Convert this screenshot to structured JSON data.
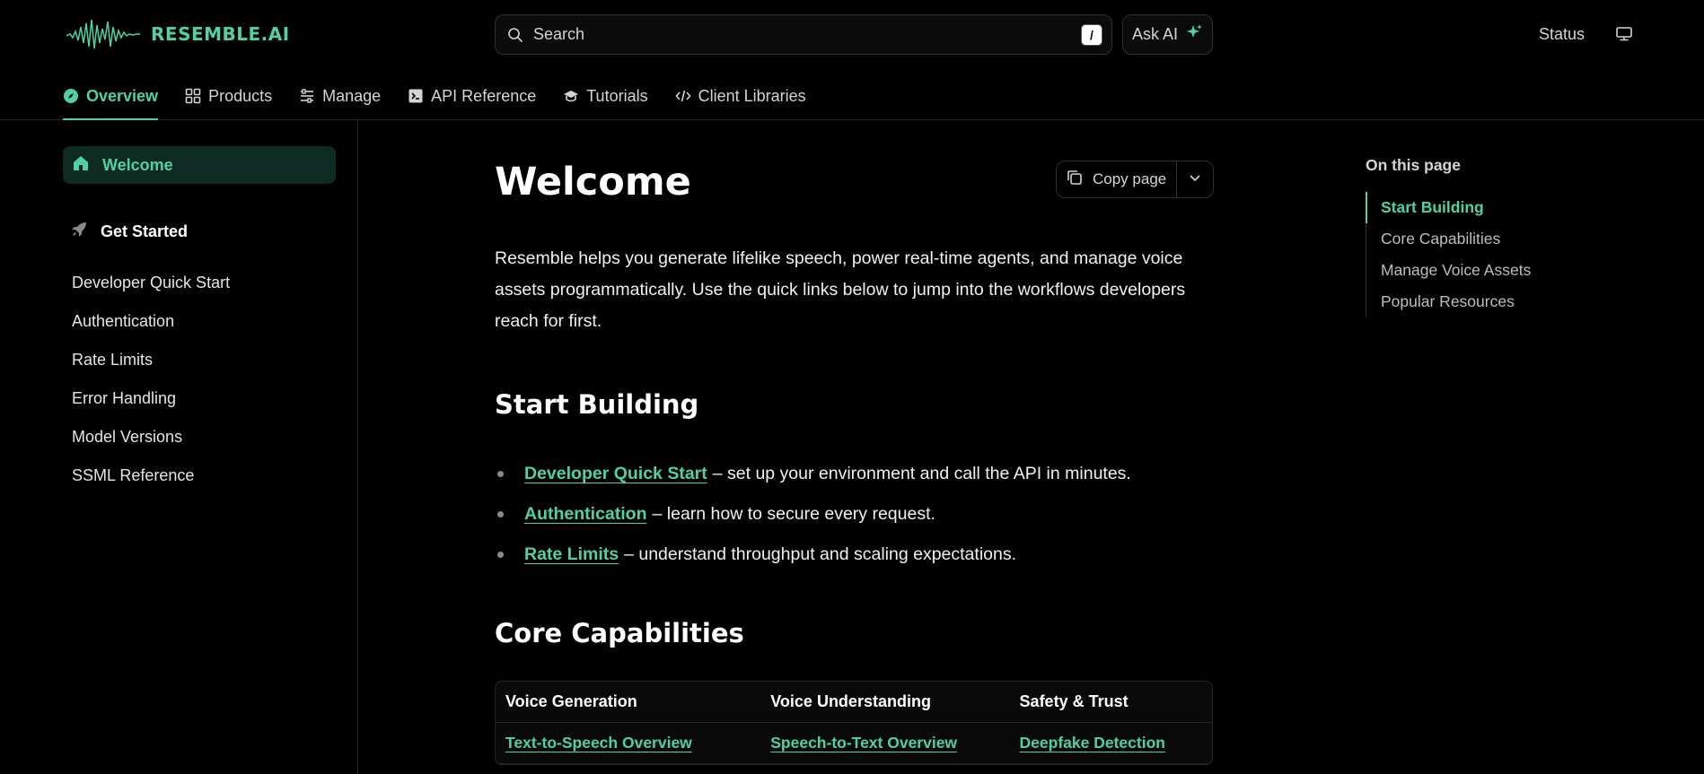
{
  "brand": {
    "name": "RESEMBLE.AI",
    "accent_color": "#4fd1a5"
  },
  "header": {
    "search": {
      "placeholder": "Search",
      "shortcut": "/"
    },
    "ask_ai_label": "Ask AI",
    "status_label": "Status",
    "theme_icon": "monitor-icon"
  },
  "tabs": [
    {
      "label": "Overview",
      "icon": "compass-icon",
      "active": true
    },
    {
      "label": "Products",
      "icon": "blocks-icon"
    },
    {
      "label": "Manage",
      "icon": "sliders-icon"
    },
    {
      "label": "API Reference",
      "icon": "terminal-icon"
    },
    {
      "label": "Tutorials",
      "icon": "graduation-cap-icon"
    },
    {
      "label": "Client Libraries",
      "icon": "code-icon"
    }
  ],
  "sidebar": {
    "active_item": {
      "label": "Welcome",
      "icon": "home-icon"
    },
    "group": {
      "label": "Get Started",
      "icon": "rocket-icon"
    },
    "items": [
      {
        "label": "Developer Quick Start"
      },
      {
        "label": "Authentication"
      },
      {
        "label": "Rate Limits"
      },
      {
        "label": "Error Handling"
      },
      {
        "label": "Model Versions"
      },
      {
        "label": "SSML Reference"
      }
    ]
  },
  "main": {
    "title": "Welcome",
    "copy_page_label": "Copy page",
    "intro": "Resemble helps you generate lifelike speech, power real-time agents, and manage voice assets programmatically. Use the quick links below to jump into the workflows developers reach for first.",
    "start_building": {
      "heading": "Start Building",
      "items": [
        {
          "link": "Developer Quick Start",
          "text": "– set up your environment and call the API in minutes."
        },
        {
          "link": "Authentication",
          "text": "– learn how to secure every request."
        },
        {
          "link": "Rate Limits",
          "text": "– understand throughput and scaling expectations."
        }
      ]
    },
    "core_capabilities": {
      "heading": "Core Capabilities",
      "columns": [
        "Voice Generation",
        "Voice Understanding",
        "Safety & Trust"
      ],
      "rows": [
        [
          "Text-to-Speech Overview",
          "Speech-to-Text Overview",
          "Deepfake Detection"
        ]
      ]
    }
  },
  "toc": {
    "title": "On this page",
    "items": [
      {
        "label": "Start Building",
        "active": true
      },
      {
        "label": "Core Capabilities"
      },
      {
        "label": "Manage Voice Assets"
      },
      {
        "label": "Popular Resources"
      }
    ]
  }
}
